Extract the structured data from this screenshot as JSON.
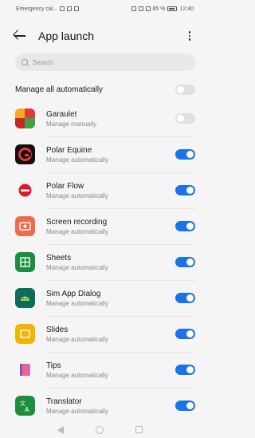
{
  "status": {
    "left_text": "Emergency cal...",
    "right_text": "85 %",
    "time": "12:40"
  },
  "appbar": {
    "title": "App launch"
  },
  "search": {
    "placeholder": "Search"
  },
  "manage_all": {
    "label": "Manage all automatically",
    "enabled": false
  },
  "apps": [
    {
      "name": "Garaulet",
      "mode": "Manage manually",
      "icon": "garaulet-icon",
      "enabled": false
    },
    {
      "name": "Polar Equine",
      "mode": "Manage automatically",
      "icon": "polar-equine-icon",
      "enabled": true
    },
    {
      "name": "Polar Flow",
      "mode": "Manage automatically",
      "icon": "polar-flow-icon",
      "enabled": true
    },
    {
      "name": "Screen recording",
      "mode": "Manage automatically",
      "icon": "screen-recording-icon",
      "enabled": true
    },
    {
      "name": "Sheets",
      "mode": "Manage automatically",
      "icon": "sheets-icon",
      "enabled": true
    },
    {
      "name": "Sim App Dialog",
      "mode": "Manage automatically",
      "icon": "sim-app-dialog-icon",
      "enabled": true
    },
    {
      "name": "Slides",
      "mode": "Manage automatically",
      "icon": "slides-icon",
      "enabled": true
    },
    {
      "name": "Tips",
      "mode": "Manage automatically",
      "icon": "tips-icon",
      "enabled": true
    },
    {
      "name": "Translator",
      "mode": "Manage automatically",
      "icon": "translator-icon",
      "enabled": true
    }
  ],
  "colors": {
    "accent": "#1a73e8",
    "toggle_off": "#e0e0e0"
  }
}
